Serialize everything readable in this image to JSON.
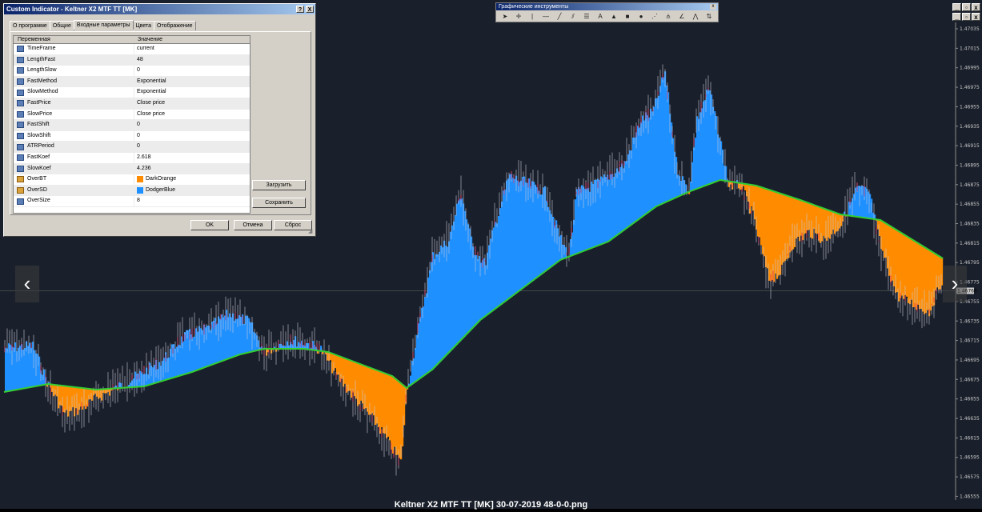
{
  "dialog": {
    "title": "Custom Indicator - Keltner X2 MTF TT [MK]",
    "help_btn": "?",
    "close_btn": "X",
    "tabs": [
      "О программе",
      "Общие",
      "Входные параметры",
      "Цвета",
      "Отображение"
    ],
    "active_tab_index": 2,
    "table_headers": {
      "variable": "Переменная",
      "value": "Значение"
    },
    "params": [
      {
        "name": "TimeFrame",
        "value": "current",
        "icon": "int-icon"
      },
      {
        "name": "LengthFast",
        "value": "48",
        "icon": "int-icon"
      },
      {
        "name": "LengthSlow",
        "value": "0",
        "icon": "int-icon"
      },
      {
        "name": "FastMethod",
        "value": "Exponential",
        "icon": "int-icon"
      },
      {
        "name": "SlowMethod",
        "value": "Exponential",
        "icon": "int-icon"
      },
      {
        "name": "FastPrice",
        "value": "Close price",
        "icon": "int-icon"
      },
      {
        "name": "SlowPrice",
        "value": "Close price",
        "icon": "int-icon"
      },
      {
        "name": "FastShift",
        "value": "0",
        "icon": "int-icon"
      },
      {
        "name": "SlowShift",
        "value": "0",
        "icon": "int-icon"
      },
      {
        "name": "ATRPeriod",
        "value": "0",
        "icon": "int-icon"
      },
      {
        "name": "FastKoef",
        "value": "2.618",
        "icon": "double-icon"
      },
      {
        "name": "SlowKoef",
        "value": "4.236",
        "icon": "double-icon"
      },
      {
        "name": "OverBT",
        "value": "DarkOrange",
        "icon": "color-icon",
        "swatch": "#ff8c00"
      },
      {
        "name": "OverSD",
        "value": "DodgerBlue",
        "icon": "color-icon",
        "swatch": "#1e90ff"
      },
      {
        "name": "OverSize",
        "value": "8",
        "icon": "int-icon"
      }
    ],
    "load_btn": "Загрузить",
    "save_btn": "Сохранить",
    "ok_btn": "OK",
    "cancel_btn": "Отмена",
    "reset_btn": "Сброс"
  },
  "graphic_tools": {
    "title": "Графические инструменты",
    "close": "x",
    "tools": [
      "cursor-icon",
      "crosshair-icon",
      "vertical-line-icon",
      "horizontal-line-icon",
      "trendline-icon",
      "channel-icon",
      "fibonacci-icon",
      "text-icon",
      "label-icon",
      "rectangle-icon",
      "ellipse-icon",
      "triangle-icon",
      "pitchfork-icon",
      "gann-icon",
      "fib-fan-icon",
      "arrows-icon"
    ]
  },
  "mdi": {
    "minimize": "_",
    "restore": "▫",
    "close": "x"
  },
  "price_axis": {
    "labels": [
      "1.47035",
      "1.47015",
      "1.46995",
      "1.46975",
      "1.46955",
      "1.46935",
      "1.46915",
      "1.46895",
      "1.46875",
      "1.46855",
      "1.46835",
      "1.46815",
      "1.46795",
      "1.46775",
      "1.46755",
      "1.46735",
      "1.46715",
      "1.46695",
      "1.46675",
      "1.46655",
      "1.46635",
      "1.46615",
      "1.46595",
      "1.46575",
      "1.46555"
    ],
    "current_price": "1.46766"
  },
  "nav": {
    "prev": "‹",
    "next": "›"
  },
  "caption": "Keltner X2 MTF TT [MK] 30-07-2019 48-0-0.png",
  "colors": {
    "background": "#1a202b",
    "over_bt": "#ff8c00",
    "over_sd": "#1e90ff",
    "keltner_line": "#32cd32",
    "candle": "#c8c8d8"
  }
}
